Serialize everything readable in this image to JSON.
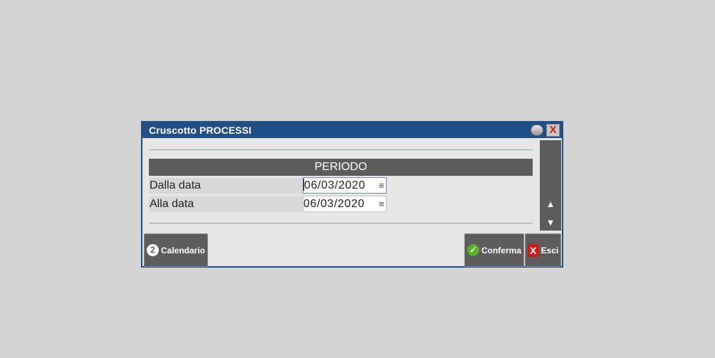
{
  "dialog": {
    "title": "Cruscotto PROCESSI",
    "close_glyph": "X",
    "section_title": "PERIODO",
    "fields": [
      {
        "label": "Dalla data",
        "value": "06/03/2020"
      },
      {
        "label": "Alla data",
        "value": "06/03/2020"
      }
    ],
    "field_menu_glyph": "≡",
    "scroll_up_glyph": "▲",
    "scroll_down_glyph": "▼"
  },
  "buttons": {
    "calendario": {
      "label": "Calendario",
      "shortcut": "2"
    },
    "conferma": {
      "label": "Conferma",
      "icon_glyph": "✓"
    },
    "esci": {
      "label": "Esci",
      "icon_glyph": "X"
    }
  },
  "colors": {
    "titlebar": "#1f4f86",
    "dialog_bg": "#e6e6e6",
    "header_bg": "#5c5c5c",
    "button_bg": "#5d5d5d",
    "ok_icon": "#58b12d",
    "close_icon": "#d11919"
  },
  "icons": [
    "minimize-icon",
    "close-icon",
    "calendar-shortcut-icon",
    "check-icon",
    "exit-icon",
    "menu-icon",
    "scroll-up-icon",
    "scroll-down-icon"
  ]
}
